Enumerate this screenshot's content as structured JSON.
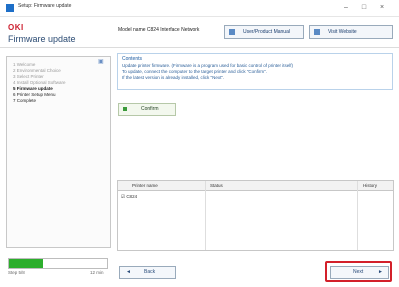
{
  "window": {
    "title": "Setup: Firmware update",
    "controls": {
      "minimize": "–",
      "maximize": "□",
      "close": "×"
    }
  },
  "header": {
    "brand": "OKI",
    "page_title": "Firmware update",
    "model": "Model name C824  Interface Network",
    "user_manual_label": "User/Product Manual",
    "website_label": "Visit Website"
  },
  "sidebar": {
    "items": [
      {
        "label": "1 Welcome",
        "active": false
      },
      {
        "label": "2 Environmental Choice",
        "active": false
      },
      {
        "label": "3 Select Printer",
        "active": false
      },
      {
        "label": "4 Install Optional Software",
        "active": false
      },
      {
        "label": "5 Firmware update",
        "active": true
      },
      {
        "label": "6 Printer Setup Menu",
        "active": true
      },
      {
        "label": "7 Complete",
        "active": true
      }
    ]
  },
  "notice": {
    "heading": "Contents",
    "lines": [
      "Update printer firmware. (Firmware is a program used for basic control of printer itself)",
      "To update, connect the computer to the target printer and click \"Confirm\".",
      "If the latest version is already installed, click \"Next\"."
    ]
  },
  "confirm_label": "Confirm",
  "table": {
    "headers": [
      "Printer name",
      "Status",
      "History"
    ],
    "rows": [
      {
        "printer": "C824",
        "status": "",
        "history": ""
      }
    ]
  },
  "progress": {
    "value": 0.35,
    "left_label": "Step 5/8",
    "right_label": "12 min"
  },
  "nav": {
    "back_label": "Back",
    "next_label": "Next"
  },
  "colors": {
    "accent": "#d3202a",
    "brand": "#cc1f2f",
    "progress": "#2cae2c"
  }
}
